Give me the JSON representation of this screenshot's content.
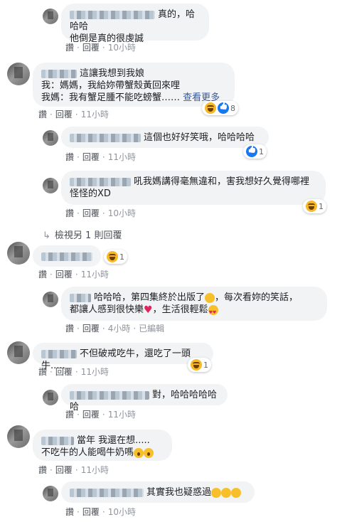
{
  "actions": {
    "like": "讚",
    "reply": "回覆",
    "edited": "已編輯"
  },
  "comments": [
    {
      "text": "真的，哈哈哈",
      "line2": "他倒是真的很虔誠",
      "time": "10小時"
    },
    {
      "text": "這讓我想到我娘",
      "line2": "我：媽媽，我給妳帶蟹殼黃回來哩",
      "line3": "我媽：我有蟹足腫不能吃螃蟹……",
      "see_more": "查看更多",
      "react_count": "8",
      "time": "11小時"
    },
    {
      "text": "這個也好好笑哦，哈哈哈哈",
      "react_count": "1",
      "time": "11小時"
    },
    {
      "text": "吼我媽講得毫無違和，害我想好久覺得哪裡",
      "line2": "怪怪的XD",
      "react_count": "1",
      "time": "10小時"
    },
    {
      "view_more": "檢視另 1 則回覆"
    },
    {
      "react_count": "1",
      "time": "11小時"
    },
    {
      "text": "哈哈哈，第四集終於出版了",
      "text_b": "，每次看妳的笑話，",
      "line2": "都讓人感到很快樂",
      "line2_b": "，生活很輕鬆",
      "time": "4小時"
    },
    {
      "text": "不但破戒吃牛，還吃了一頭牛.....",
      "react_count": "1",
      "time": "11小時"
    },
    {
      "text": "對，哈哈哈哈哈哈",
      "time": "11小時"
    },
    {
      "text": "當年 我還在想.....",
      "line2": "不吃牛的人能喝牛奶嗎",
      "time": "11小時"
    },
    {
      "text": "其實我也疑惑過",
      "time": "10小時"
    }
  ]
}
